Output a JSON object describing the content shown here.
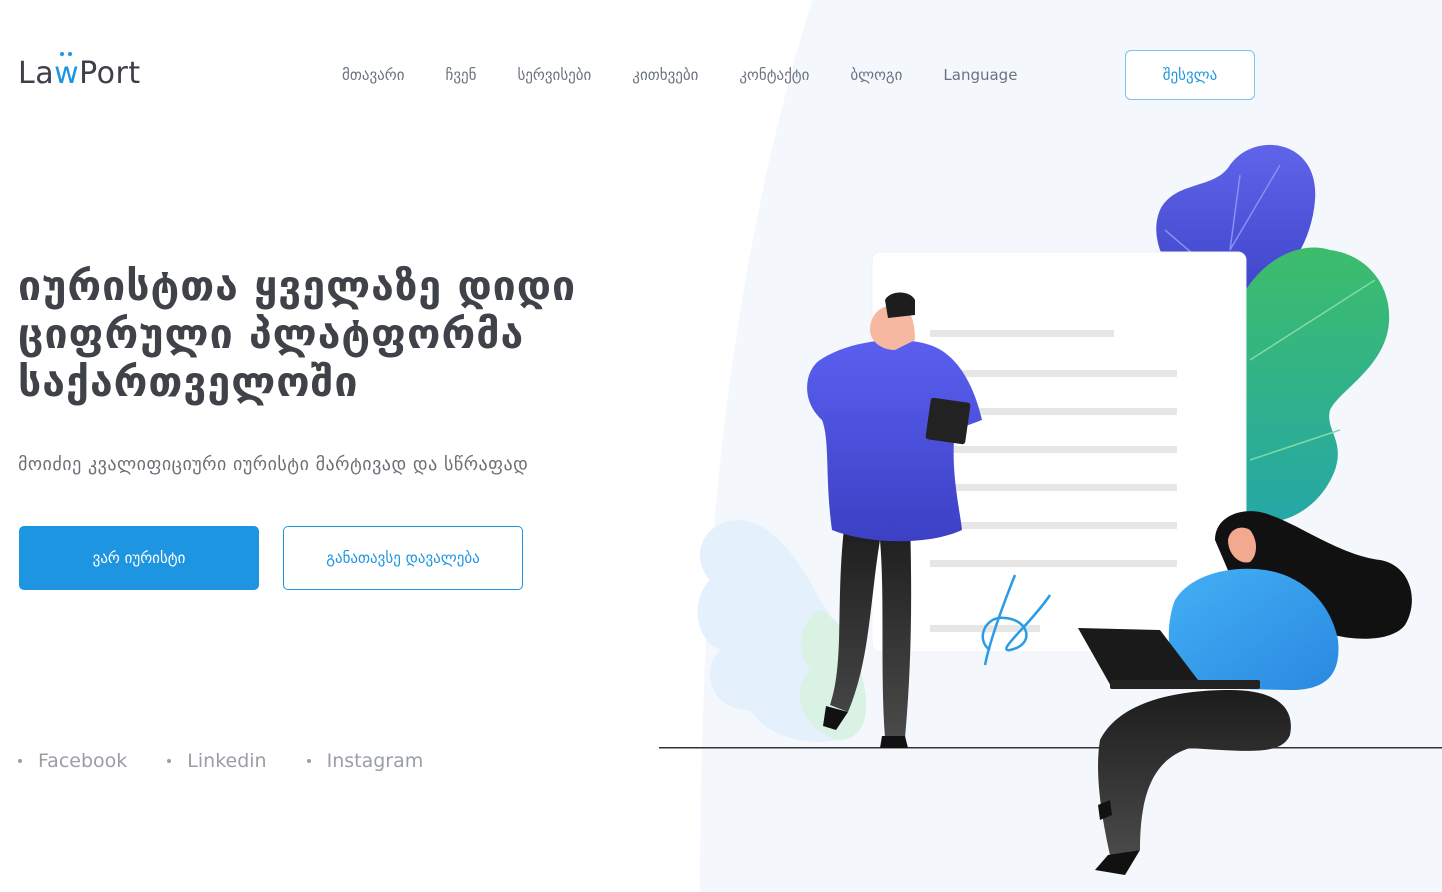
{
  "brand": {
    "logo_prefix": "La",
    "logo_w": "w",
    "logo_suffix": "Port"
  },
  "nav": {
    "items": [
      {
        "label": "მთავარი"
      },
      {
        "label": "ჩვენ"
      },
      {
        "label": "სერვისები"
      },
      {
        "label": "კითხვები"
      },
      {
        "label": "კონტაქტი"
      },
      {
        "label": "ბლოგი"
      },
      {
        "label": "Language"
      }
    ],
    "login_label": "შესვლა"
  },
  "hero": {
    "title_line1": "იურისტთა ყველაზე დიდი",
    "title_line2": "ციფრული პლატფორმა",
    "title_line3": "საქართველოში",
    "subtitle": "მოიძიე კვალიფიციური იურისტი მარტივად და სწრაფად",
    "primary_button": "ვარ იურისტი",
    "secondary_button": "განათავსე დავალება"
  },
  "social": {
    "items": [
      {
        "label": "Facebook"
      },
      {
        "label": "Linkedin"
      },
      {
        "label": "Instagram"
      }
    ]
  },
  "colors": {
    "accent": "#1e95e0",
    "text_dark": "#3f4248",
    "text_muted": "#6b7280",
    "leaf_purple": "#5b5de6",
    "leaf_green": "#38b86f",
    "man_sweater": "#4f56e0",
    "woman_sweater": "#3aa0ee"
  }
}
